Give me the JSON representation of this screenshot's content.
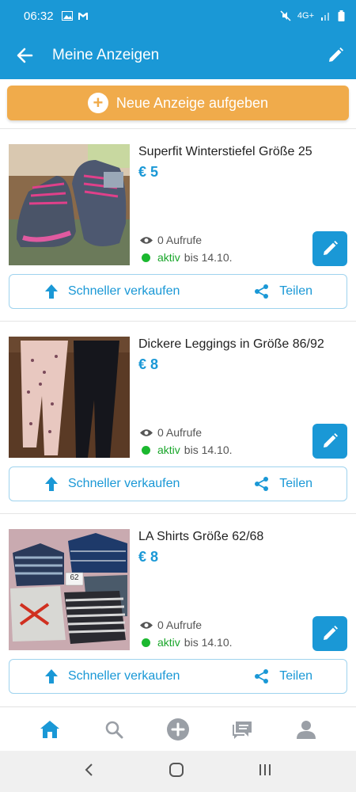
{
  "status_bar": {
    "time": "06:32",
    "network": "4G+"
  },
  "app_bar": {
    "title": "Meine Anzeigen"
  },
  "new_ad_button": {
    "label": "Neue Anzeige aufgeben"
  },
  "ads": [
    {
      "title": "Superfit Winterstiefel Größe 25",
      "price": "€ 5",
      "views": "0 Aufrufe",
      "status": "aktiv",
      "until": "bis 14.10.",
      "sell_label": "Schneller verkaufen",
      "share_label": "Teilen"
    },
    {
      "title": "Dickere Leggings in Größe 86/92",
      "price": "€ 8",
      "views": "0 Aufrufe",
      "status": "aktiv",
      "until": "bis 14.10.",
      "sell_label": "Schneller verkaufen",
      "share_label": "Teilen"
    },
    {
      "title": "LA Shirts Größe 62/68",
      "price": "€ 8",
      "views": "0 Aufrufe",
      "status": "aktiv",
      "until": "bis 14.10.",
      "sell_label": "Schneller verkaufen",
      "share_label": "Teilen",
      "tag_label": "62"
    }
  ],
  "bottom_nav": {
    "items": [
      "home-icon",
      "search-icon",
      "add-circle-icon",
      "messages-icon",
      "profile-icon"
    ]
  },
  "colors": {
    "primary": "#1a98d6",
    "accent": "#f0ab4b",
    "active": "#1aa62b"
  }
}
